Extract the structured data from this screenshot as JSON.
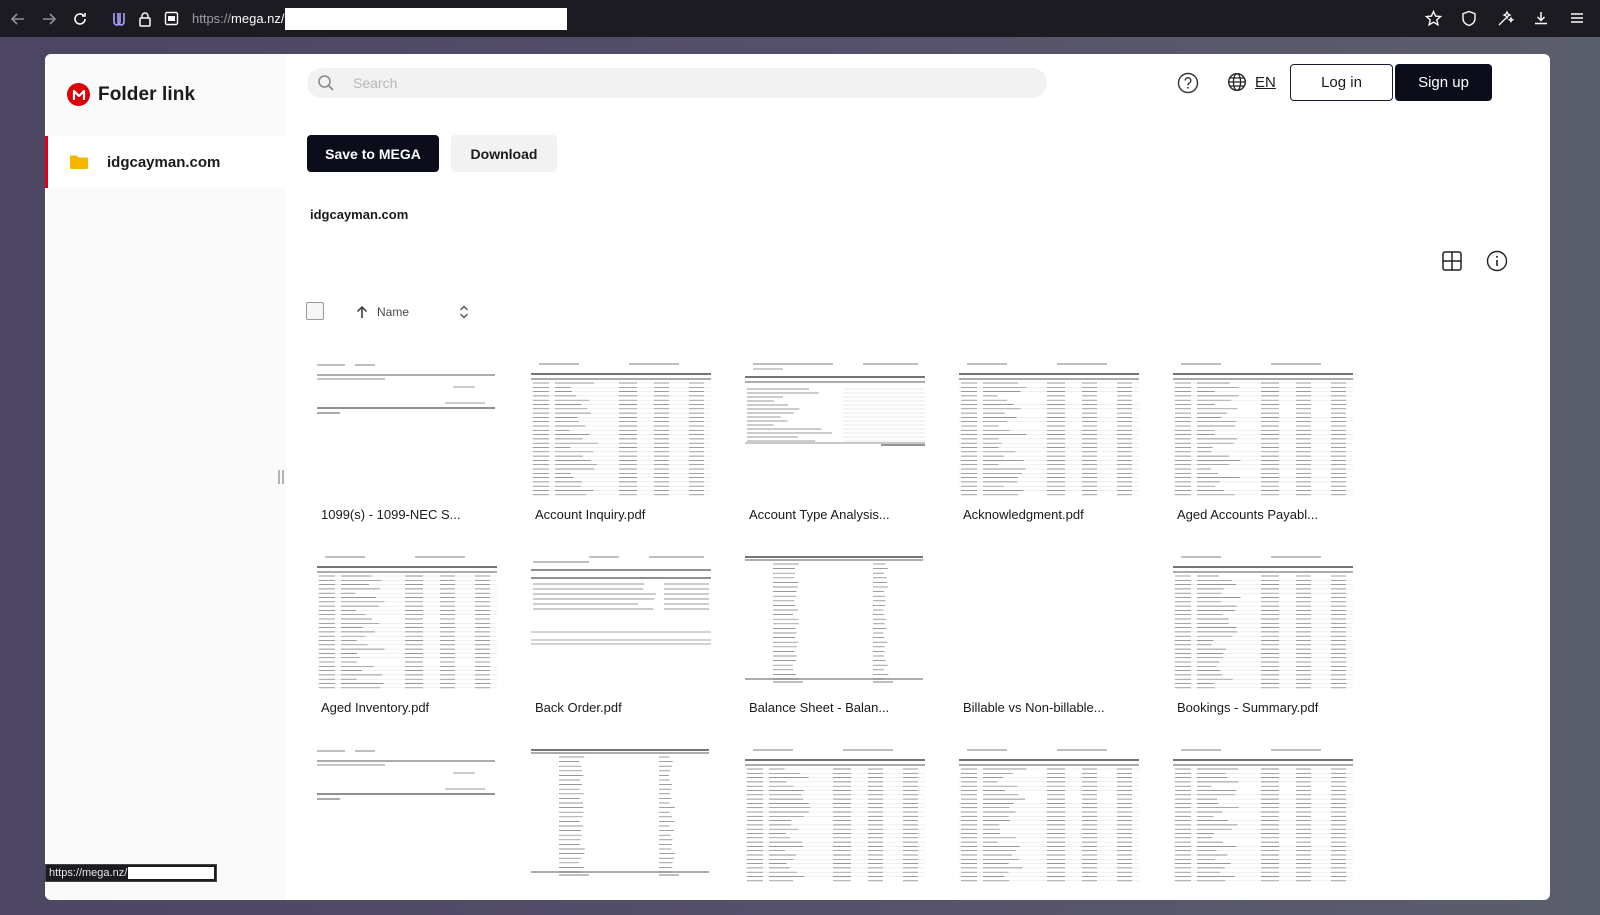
{
  "browser": {
    "url_prefix": "https://",
    "url_host": "mega.nz/"
  },
  "brand": {
    "title": "Folder link",
    "logo_letter": "M"
  },
  "sidebar": {
    "folder_name": "idgcayman.com"
  },
  "header": {
    "search_placeholder": "Search",
    "language": "EN",
    "login_label": "Log in",
    "signup_label": "Sign up"
  },
  "toolbar": {
    "save_label": "Save to MEGA",
    "download_label": "Download"
  },
  "breadcrumb": "idgcayman.com",
  "list_header": {
    "sort_label": "Name"
  },
  "files": [
    {
      "name": "1099(s) - 1099-NEC S...",
      "thumb": "sparse"
    },
    {
      "name": "Account Inquiry.pdf",
      "thumb": "dense"
    },
    {
      "name": "Account Type Analysis...",
      "thumb": "list"
    },
    {
      "name": "Acknowledgment.pdf",
      "thumb": "dense"
    },
    {
      "name": "Aged Accounts Payabl...",
      "thumb": "dense"
    },
    {
      "name": "Aged Inventory.pdf",
      "thumb": "dense"
    },
    {
      "name": "Back Order.pdf",
      "thumb": "partial"
    },
    {
      "name": "Balance Sheet - Balan...",
      "thumb": "columns"
    },
    {
      "name": "Billable vs Non-billable...",
      "thumb": "blank"
    },
    {
      "name": "Bookings - Summary.pdf",
      "thumb": "dense"
    },
    {
      "name": "",
      "thumb": "sparse"
    },
    {
      "name": "",
      "thumb": "columns"
    },
    {
      "name": "",
      "thumb": "dense"
    },
    {
      "name": "",
      "thumb": "dense"
    },
    {
      "name": "",
      "thumb": "dense"
    }
  ],
  "status_bar": {
    "url": "https://mega.nz/"
  },
  "colors": {
    "brand_red": "#d90007",
    "primary_dark": "#0b0d1a",
    "folder_yellow": "#f7b500"
  }
}
